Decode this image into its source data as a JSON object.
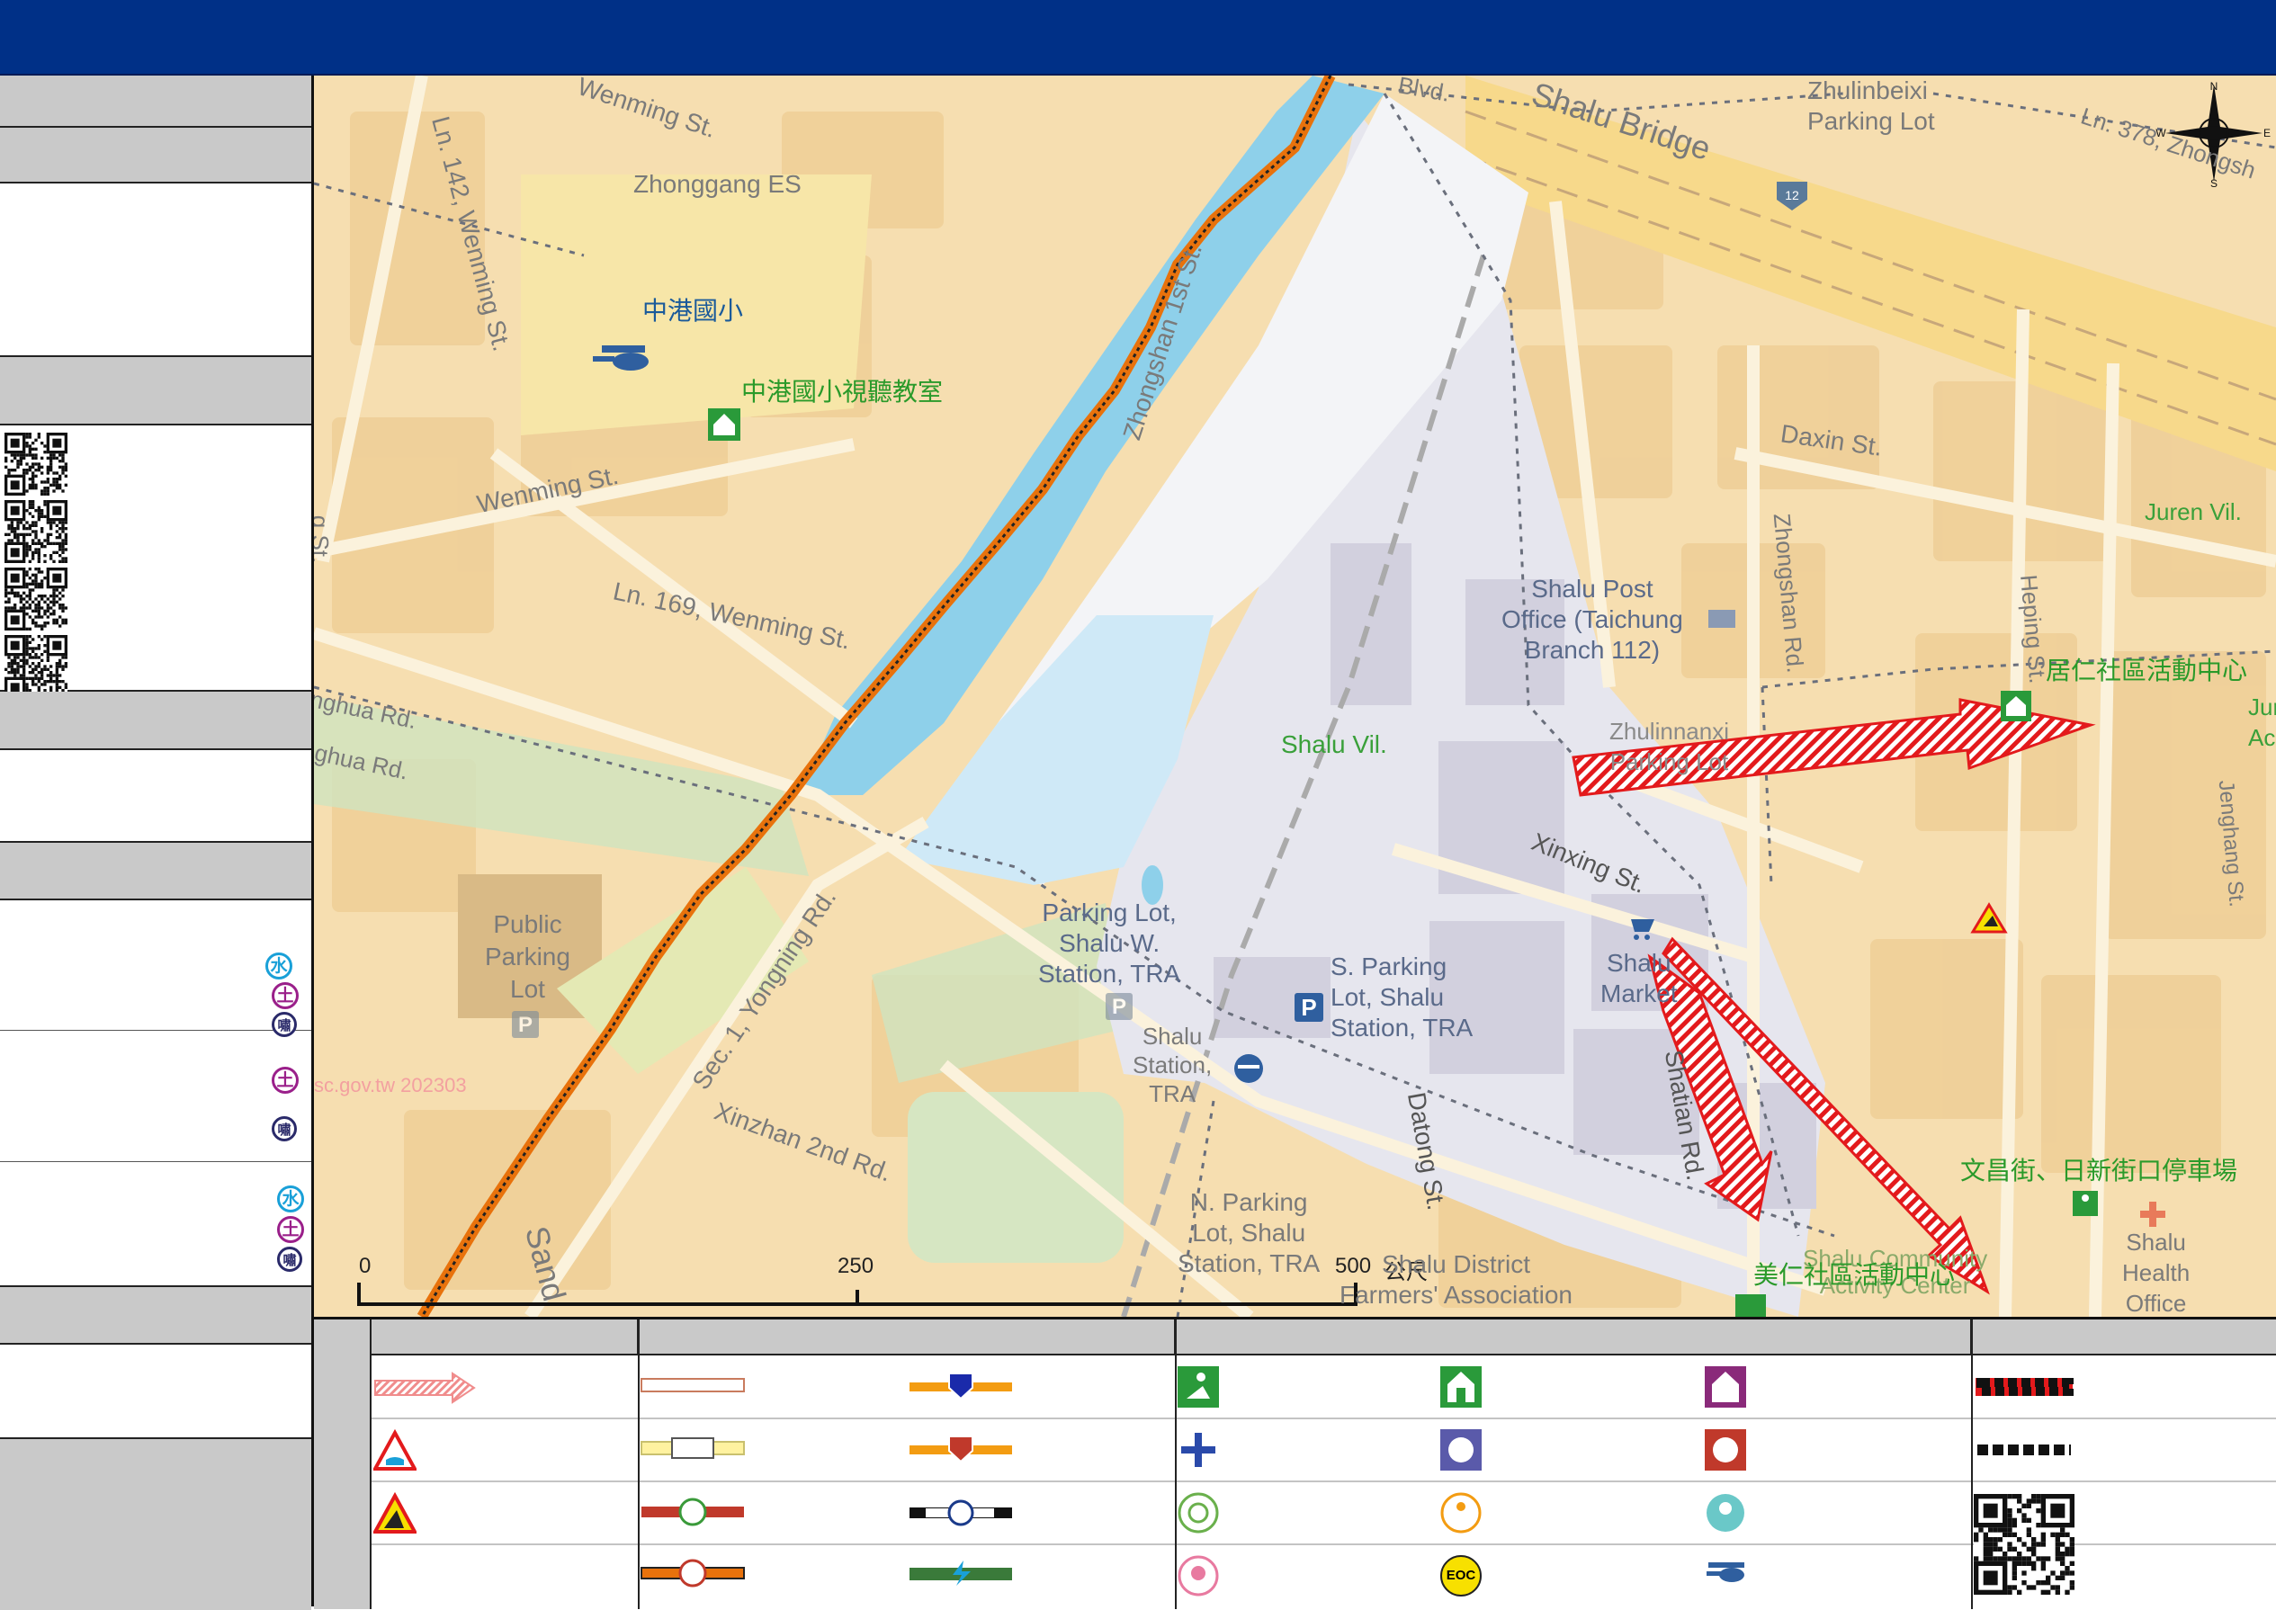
{
  "map": {
    "scale": {
      "tick0": "0",
      "tick1": "250",
      "tick2": "500",
      "unit": "公尺"
    },
    "watermark": "sc.gov.tw 202303",
    "streets": [
      {
        "id": "wenming_n",
        "text": "Wenming St."
      },
      {
        "id": "wenming_ln142",
        "text": "Ln. 142, Wenming St."
      },
      {
        "id": "wenming",
        "text": "Wenming St."
      },
      {
        "id": "wenming_ln169",
        "text": "Ln. 169, Wenming St."
      },
      {
        "id": "zhonghua1",
        "text": "nghua Rd."
      },
      {
        "id": "zhonghua2",
        "text": "ghua Rd."
      },
      {
        "id": "zhonghua_st",
        "text": "g St."
      },
      {
        "id": "yongning",
        "text": "Sec. 1, Yongning Rd."
      },
      {
        "id": "xinzhan",
        "text": "Xinzhan 2nd Rd."
      },
      {
        "id": "zhongshan1st",
        "text": "Zhongshan 1st St."
      },
      {
        "id": "shalu_bridge",
        "text": "Shalu Bridge"
      },
      {
        "id": "blvd",
        "text": "Blvd."
      },
      {
        "id": "daxin",
        "text": "Daxin St."
      },
      {
        "id": "zhongshan_rd",
        "text": "Zhongshan Rd."
      },
      {
        "id": "heping",
        "text": "Heping St."
      },
      {
        "id": "xinxing",
        "text": "Xinxing St."
      },
      {
        "id": "shatian",
        "text": "Shatian Rd."
      },
      {
        "id": "datong",
        "text": "Datong St."
      },
      {
        "id": "ln378",
        "text": "Ln. 378, Zhongsh"
      },
      {
        "id": "zhenghang",
        "text": "Jenghang St."
      },
      {
        "id": "sand",
        "text": "Sand"
      }
    ],
    "places": [
      {
        "id": "zhonggang_es",
        "text": "Zhonggang ES",
        "color": "#7a7a7a"
      },
      {
        "id": "public_parking",
        "text": "Public\nParking\nLot",
        "color": "#7a7a7a"
      },
      {
        "id": "parking_w",
        "text": "Parking Lot,\nShalu W.\nStation, TRA",
        "color": "#5a6a8a"
      },
      {
        "id": "s_parking",
        "text": "S. Parking\nLot, Shalu\nStation, TRA",
        "color": "#5a6a8a"
      },
      {
        "id": "shalu_station",
        "text": "Shalu\nStation,\nTRA",
        "color": "#7a7a7a"
      },
      {
        "id": "n_parking",
        "text": "N. Parking\nLot, Shalu\nStation, TRA",
        "color": "#7a7a7a"
      },
      {
        "id": "post_office",
        "text": "Shalu Post\nOffice (Taichung\nBranch 112)",
        "color": "#5a6a8a"
      },
      {
        "id": "shalu_vil",
        "text": "Shalu Vil.",
        "color": "#3aa03a"
      },
      {
        "id": "juren_vil",
        "text": "Juren Vil.",
        "color": "#3aa03a"
      },
      {
        "id": "zhulinbeixi",
        "text": "Zhulinbeixi\nParking Lot",
        "color": "#7a7a7a"
      },
      {
        "id": "zhulinnanxi",
        "text": "Zhulinnanxi\nParking Lot",
        "color": "#7a7a7a"
      },
      {
        "id": "shalu_market",
        "text": "Shalu\nMarket",
        "color": "#5a6a8a"
      },
      {
        "id": "farmers",
        "text": "Shalu District\nFarmers' Association",
        "color": "#7a7a7a"
      },
      {
        "id": "community_center",
        "text": "Shalu Community\nActivity Center",
        "color": "#7a7a7a"
      },
      {
        "id": "health_office",
        "text": "Shalu\nHealth\nOffice",
        "color": "#7a7a7a"
      },
      {
        "id": "juren_ac",
        "text": "Jur\nAc",
        "color": "#3aa03a"
      }
    ],
    "shelters": [
      {
        "id": "zhonggang_heli",
        "text": "中港國小",
        "color": "#1a5a9a"
      },
      {
        "id": "zhonggang_av",
        "text": "中港國小視聽教室",
        "color": "#2a9a2a"
      },
      {
        "id": "juren_center",
        "text": "居仁社區活動中心",
        "color": "#2a9a2a"
      },
      {
        "id": "wenchang_parking",
        "text": "文昌街、日新街口停車場",
        "color": "#2a9a2a"
      },
      {
        "id": "meiren_center",
        "text": "美仁社區活動中心",
        "color": "#2a9a2a"
      }
    ]
  },
  "sidebar": {
    "symbols": [
      "水",
      "土",
      "嘯"
    ]
  },
  "legend": {
    "eoc_label": "EOC"
  }
}
